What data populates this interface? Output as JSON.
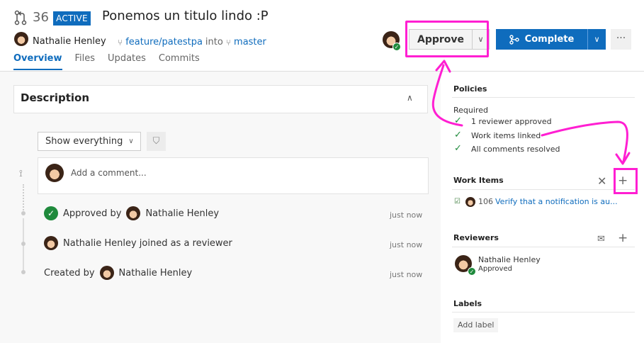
{
  "header": {
    "pr_number": "36",
    "status_badge": "ACTIVE",
    "title": "Ponemos un titulo lindo :P",
    "author": "Nathalie Henley",
    "source_branch": "feature/patestpa",
    "into_word": "into",
    "target_branch": "master"
  },
  "tabs": [
    "Overview",
    "Files",
    "Updates",
    "Commits"
  ],
  "actions": {
    "approve_label": "Approve",
    "complete_label": "Complete",
    "more_label": "···"
  },
  "description": {
    "title": "Description"
  },
  "filter": {
    "selected": "Show everything"
  },
  "comment": {
    "placeholder": "Add a comment..."
  },
  "timeline": [
    {
      "prefix": "Approved by",
      "user": "Nathalie Henley",
      "text": "",
      "time": "just now"
    },
    {
      "prefix": "",
      "user": "",
      "text": "Nathalie Henley joined as a reviewer",
      "time": "just now"
    },
    {
      "prefix": "Created by",
      "user": "Nathalie Henley",
      "text": "",
      "time": "just now"
    }
  ],
  "policies": {
    "title": "Policies",
    "required_label": "Required",
    "items": [
      "1 reviewer approved",
      "Work items linked",
      "All comments resolved"
    ]
  },
  "work_items": {
    "title": "Work Items",
    "item": {
      "id": "106",
      "title": "Verify that a notification is au..."
    }
  },
  "reviewers": {
    "title": "Reviewers",
    "items": [
      {
        "name": "Nathalie Henley",
        "vote": "Approved"
      }
    ]
  },
  "labels": {
    "title": "Labels",
    "add_label": "Add label"
  },
  "colors": {
    "accent": "#0f6cbd",
    "success": "#1f8a3c",
    "annotation": "#ff1fd2"
  }
}
